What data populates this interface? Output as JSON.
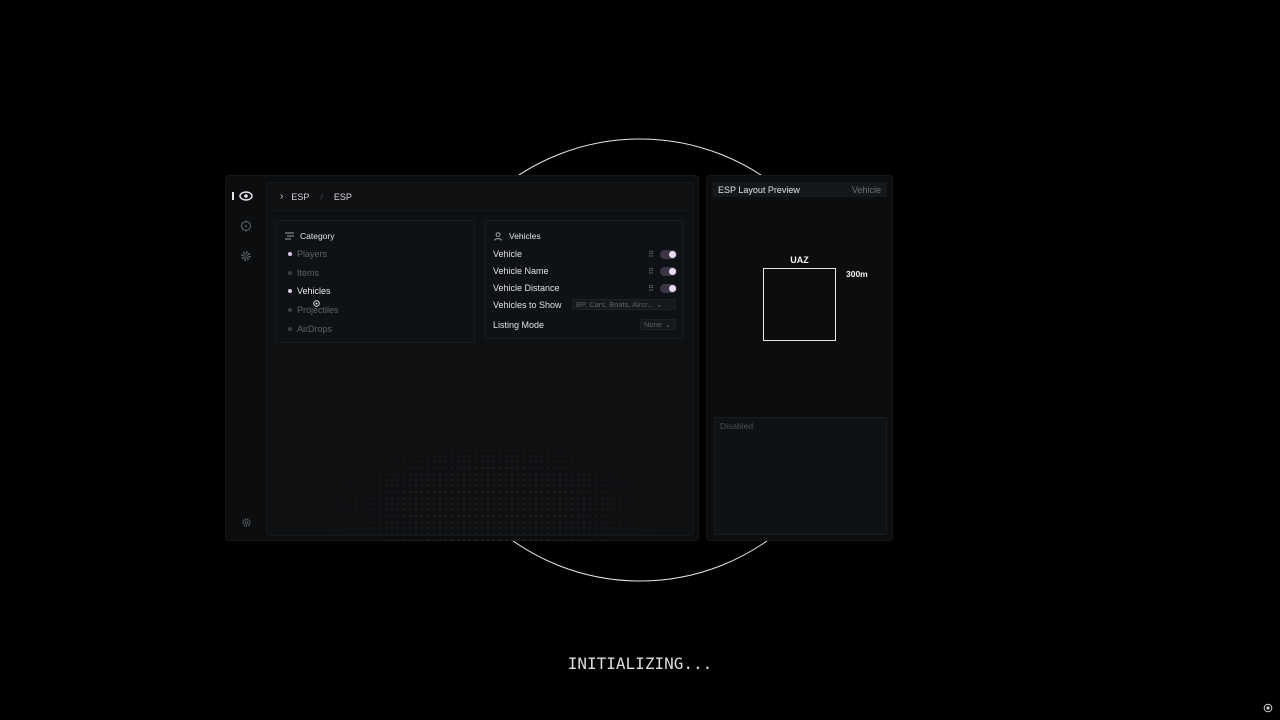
{
  "breadcrumb": {
    "root": "ESP",
    "separator": "/",
    "current": "ESP"
  },
  "category": {
    "title": "Category",
    "items": [
      {
        "label": "Players"
      },
      {
        "label": "Items"
      },
      {
        "label": "Vehicles"
      },
      {
        "label": "Projectiles"
      },
      {
        "label": "AirDrops"
      }
    ],
    "selected": "Vehicles"
  },
  "vehicles": {
    "title": "Vehicles",
    "options": [
      {
        "label": "Vehicle",
        "enabled": true
      },
      {
        "label": "Vehicle Name",
        "enabled": true
      },
      {
        "label": "Vehicle Distance",
        "enabled": true
      }
    ],
    "vehicles_to_show": {
      "label": "Vehicles to Show",
      "value": "BP, Cars, Boats, Aircr..."
    },
    "listing_mode": {
      "label": "Listing Mode",
      "value": "None"
    }
  },
  "preview": {
    "title": "ESP Layout Preview",
    "subtitle": "Vehicle",
    "box_label": "UAZ",
    "distance": "300m",
    "disabled_label": "Disabled"
  },
  "status": "INITIALIZING...",
  "icons": {
    "rail": [
      "eye-icon",
      "crosshair-icon",
      "gear-icon"
    ],
    "rail_bottom": "settings-icon"
  },
  "colors": {
    "background": "#000000",
    "panel": "#0b0d0f",
    "accent": "#d9cde6",
    "toggle_track": "#3c3546"
  }
}
